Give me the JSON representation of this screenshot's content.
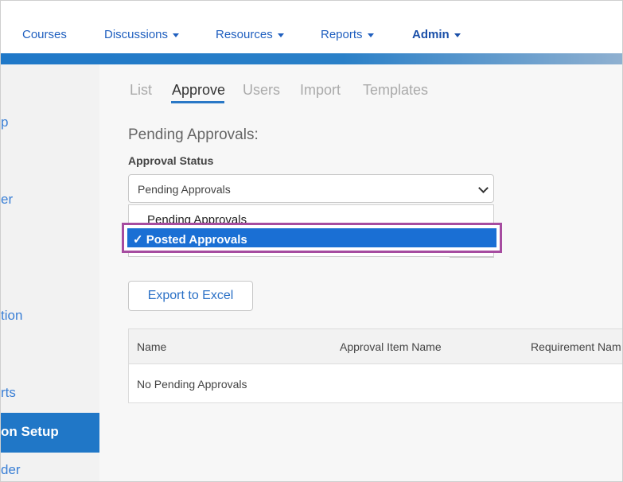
{
  "nav": {
    "items": [
      {
        "label": "Courses",
        "dropdown": false
      },
      {
        "label": "Discussions",
        "dropdown": true
      },
      {
        "label": "Resources",
        "dropdown": true
      },
      {
        "label": "Reports",
        "dropdown": true
      },
      {
        "label": "Admin",
        "dropdown": true
      }
    ]
  },
  "sidebar": {
    "items": [
      "p",
      "er",
      "tion",
      "rts"
    ],
    "active": "on Setup",
    "last": "der"
  },
  "tabs": [
    "List",
    "Approve",
    "Users",
    "Import",
    "Templates"
  ],
  "active_tab": "Approve",
  "section_title": "Pending Approvals:",
  "approval_status": {
    "label": "Approval Status",
    "selected_value": "Pending Approvals",
    "options": [
      "Pending Approvals",
      "Posted Approvals"
    ],
    "highlighted_option": "✓ Posted Approvals"
  },
  "export_button": "Export to Excel",
  "table": {
    "columns": [
      "Name",
      "Approval Item Name",
      "Requirement Nam"
    ],
    "empty_message": "No Pending Approvals"
  },
  "colors": {
    "accent": "#1f78c8",
    "sidebar_active": "#2077c7",
    "highlight_border": "#a64ca0",
    "selection": "#1a6fd4"
  }
}
